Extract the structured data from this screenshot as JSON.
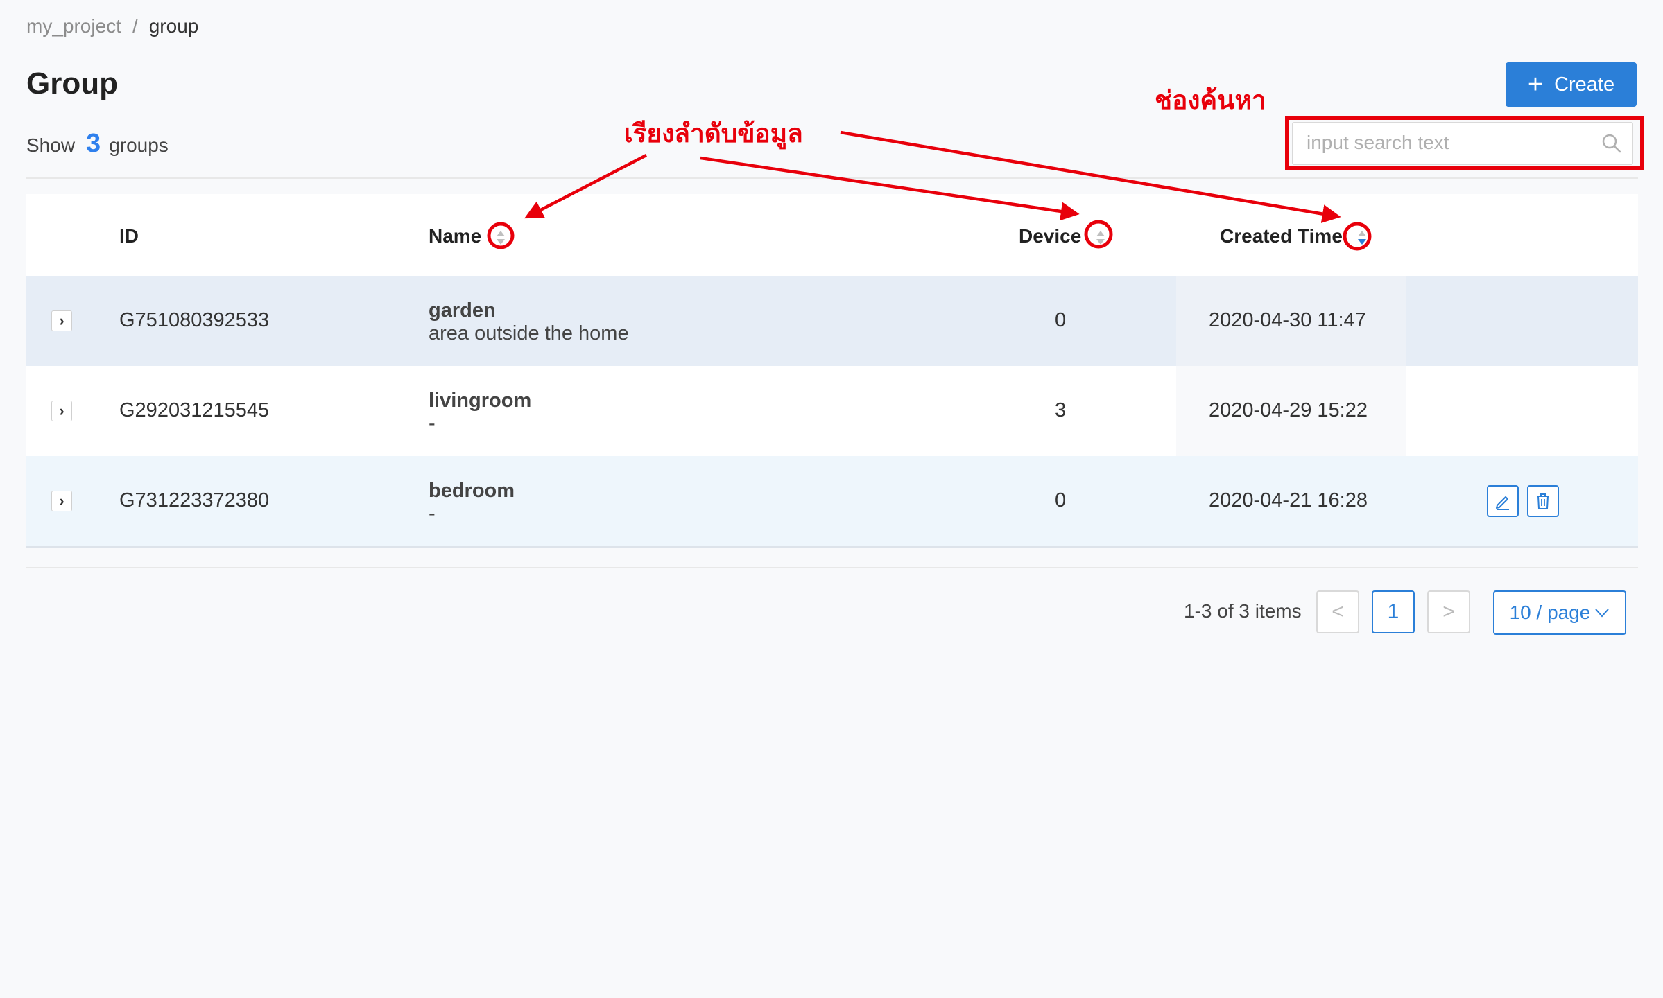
{
  "breadcrumb": {
    "project": "my_project",
    "separator": "/",
    "current": "group"
  },
  "page_title": "Group",
  "summary": {
    "prefix": "Show",
    "count": "3",
    "suffix": "groups"
  },
  "create_button": {
    "icon": "plus-icon",
    "label": "Create"
  },
  "search": {
    "placeholder": "input search text",
    "value": "",
    "icon": "search-icon"
  },
  "table": {
    "columns": {
      "id": "ID",
      "name": "Name",
      "device": "Device",
      "created_time": "Created Time"
    },
    "rows": [
      {
        "id": "G751080392533",
        "name": "garden",
        "description": "area outside the home",
        "device": "0",
        "created_time": "2020-04-30 11:47"
      },
      {
        "id": "G292031215545",
        "name": "livingroom",
        "description": "-",
        "device": "3",
        "created_time": "2020-04-29 15:22"
      },
      {
        "id": "G731223372380",
        "name": "bedroom",
        "description": "-",
        "device": "0",
        "created_time": "2020-04-21 16:28"
      }
    ],
    "row_actions": {
      "edit_icon": "edit-icon",
      "delete_icon": "trash-icon"
    }
  },
  "pagination": {
    "total_text": "1-3 of 3 items",
    "prev": "<",
    "current_page": "1",
    "next": ">",
    "page_size": "10 / page"
  },
  "annotations": {
    "sort_label": "เรียงลำดับข้อมูล",
    "search_label": "ช่องค้นหา",
    "color": "#e8000b"
  },
  "colors": {
    "primary": "#2b7fd8",
    "count": "#2f80ed",
    "annotation": "#e8000b"
  }
}
